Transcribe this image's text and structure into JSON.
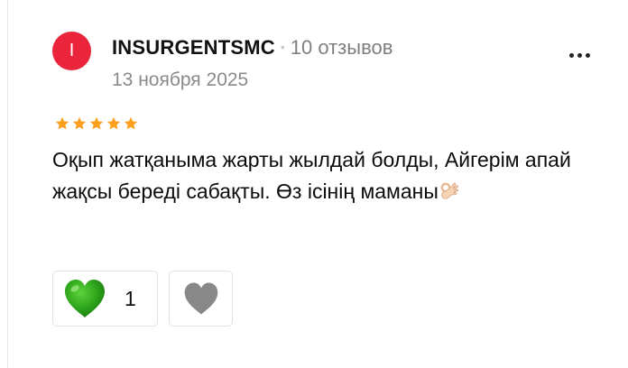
{
  "review": {
    "author": {
      "initial": "I",
      "name": "INSURGENTSMC",
      "separator": "•",
      "reviews_count": "10 отзывов",
      "avatar_color": "#e9243b"
    },
    "date": "13 ноября 2025",
    "rating": 5,
    "star_color": "#fc9f1d",
    "text": "Оқып жатқаныма жарты жылдай болды, Айгерім апай жақсы береді сабақты. Өз ісінің маманы",
    "text_emoji": "ok-hand-icon",
    "more_menu_icon": "more-dots-icon",
    "reactions": {
      "like": {
        "icon": "green-heart-icon",
        "count": "1",
        "color": "#2ca31a"
      },
      "dislike": {
        "icon": "grey-heart-icon",
        "color": "#888888"
      }
    }
  }
}
